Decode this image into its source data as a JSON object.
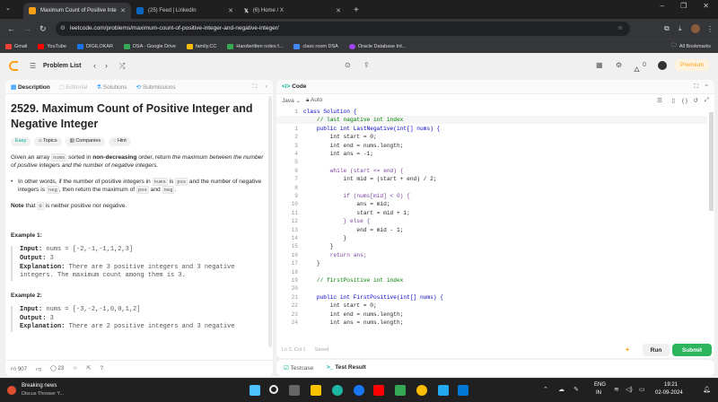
{
  "browser": {
    "tabs": [
      {
        "title": "Maximum Count of Positive Inte",
        "active": true,
        "color": "#ffa116"
      },
      {
        "title": "(25) Feed | LinkedIn",
        "active": false,
        "color": "#0a66c2"
      },
      {
        "title": "(6) Home / X",
        "active": false,
        "color": "#ffffff"
      }
    ],
    "new_tab": "+",
    "url": "leetcode.com/problems/maximum-count-of-positive-integer-and-negative-integer/",
    "bookmarks": [
      {
        "label": "Gmail",
        "color": "#ea4335"
      },
      {
        "label": "YouTube",
        "color": "#ff0000"
      },
      {
        "label": "DIGILOKAR",
        "color": "#1a73e8"
      },
      {
        "label": "DSA - Google Drive",
        "color": "#34a853"
      },
      {
        "label": "family.CC",
        "color": "#fbbc04"
      },
      {
        "label": "Handwritten notes f...",
        "color": "#34a853"
      },
      {
        "label": "class room DSA",
        "color": "#4285f4"
      },
      {
        "label": "Oracle Database Int...",
        "color": "#a142f4"
      }
    ],
    "all_bookmarks": "All Bookmarks"
  },
  "lc": {
    "problem_list": "Problem List",
    "streak": "0",
    "premium": "Premium",
    "left_tabs": [
      "Description",
      "Editorial",
      "Solutions",
      "Submissions"
    ],
    "title": "2529. Maximum Count of Positive Integer and Negative Integer",
    "tags": [
      "Easy",
      "Topics",
      "Companies",
      "Hint"
    ],
    "desc_p1_a": "Given an array ",
    "desc_p1_code": "nums",
    "desc_p1_b": " sorted in ",
    "desc_p1_bold": "non-decreasing",
    "desc_p1_c": " order, return ",
    "desc_p1_em": "the maximum between the number of positive integers and the number of negative integers.",
    "bullet_a": "In other words, if the number of positive integers in ",
    "bullet_c1": "nums",
    "bullet_b": " is ",
    "bullet_c2": "pos",
    "bullet_c": " and the number of negative integers is ",
    "bullet_c3": "neg",
    "bullet_d": ", then return the maximum of ",
    "bullet_c4": "pos",
    "bullet_e": " and ",
    "bullet_c5": "neg",
    "bullet_f": ".",
    "note_bold": "Note",
    "note_a": " that ",
    "note_code": "0",
    "note_b": " is neither positive nor negative.",
    "ex1_title": "Example 1:",
    "ex1_input": "nums = [-2,-1,-1,1,2,3]",
    "ex1_output": "3",
    "ex1_expl": "There are 3 positive integers and 3 negative integers. The maximum count among them is 3.",
    "ex2_title": "Example 2:",
    "ex2_input": "nums = [-3,-2,-1,0,0,1,2]",
    "ex2_output": "3",
    "ex2_expl": "There are 2 positive integers and 3 negative",
    "input_label": "Input:",
    "output_label": "Output:",
    "expl_label": "Explanation:",
    "likes": "907",
    "comments": "23",
    "code_tab": "Code",
    "lang": "Java",
    "auto": "Auto",
    "cursor": "Ln 2, Col 1",
    "saved": "Saved",
    "run": "Run",
    "submit": "Submit",
    "testcase": "Testcase",
    "test_result": "Test Result",
    "code_lines": [
      {
        "n": "1",
        "t": "class Solution {"
      },
      {
        "n": "2",
        "t": "    // last nagative int index"
      },
      {
        "n": "1",
        "t": "    public int LastNegative(int[] nums) {"
      },
      {
        "n": "2",
        "t": "        int start = 0;"
      },
      {
        "n": "3",
        "t": "        int end = nums.length;"
      },
      {
        "n": "4",
        "t": "        int ans = -1;"
      },
      {
        "n": "5",
        "t": ""
      },
      {
        "n": "6",
        "t": "        while (start <= end) {"
      },
      {
        "n": "7",
        "t": "            int mid = (start + end) / 2;"
      },
      {
        "n": "8",
        "t": ""
      },
      {
        "n": "9",
        "t": "            if (nums[mid] < 0) {"
      },
      {
        "n": "10",
        "t": "                ans = mid;"
      },
      {
        "n": "11",
        "t": "                start = mid + 1;"
      },
      {
        "n": "12",
        "t": "            } else {"
      },
      {
        "n": "13",
        "t": "                end = mid - 1;"
      },
      {
        "n": "14",
        "t": "            }"
      },
      {
        "n": "15",
        "t": "        }"
      },
      {
        "n": "16",
        "t": "        return ans;"
      },
      {
        "n": "17",
        "t": "    }"
      },
      {
        "n": "18",
        "t": ""
      },
      {
        "n": "19",
        "t": "    // firstPositive int index"
      },
      {
        "n": "20",
        "t": ""
      },
      {
        "n": "21",
        "t": "    public int FirstPositive(int[] nums) {"
      },
      {
        "n": "22",
        "t": "        int start = 0;"
      },
      {
        "n": "23",
        "t": "        int end = nums.length;"
      },
      {
        "n": "24",
        "t": "        int ans = nums.length;"
      }
    ]
  },
  "taskbar": {
    "news_title": "Breaking news",
    "news_sub": "Discus Thrower Y...",
    "lang": "ENG",
    "region": "IN",
    "time": "19:21",
    "date": "02-09-2024"
  }
}
